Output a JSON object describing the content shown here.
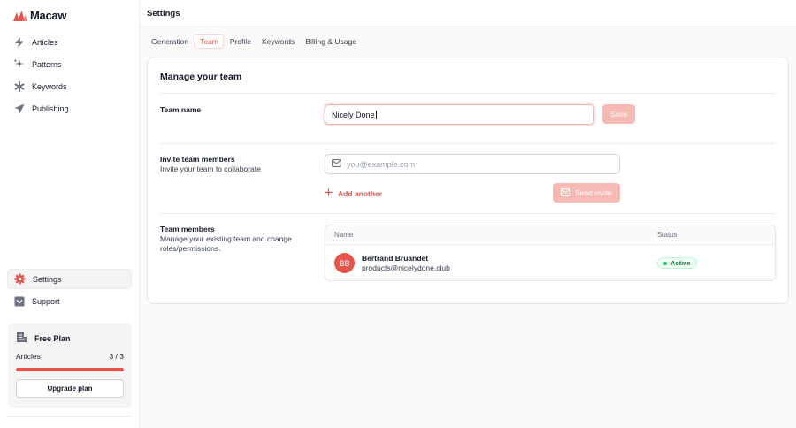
{
  "app": {
    "name": "Macaw",
    "brand_color": "#e5534b"
  },
  "sidebar": {
    "items": [
      {
        "label": "Articles",
        "icon": "lightning-icon"
      },
      {
        "label": "Patterns",
        "icon": "sparkles-icon"
      },
      {
        "label": "Keywords",
        "icon": "asterisk-icon"
      },
      {
        "label": "Publishing",
        "icon": "send-icon"
      }
    ],
    "bottom_items": [
      {
        "label": "Settings",
        "icon": "gear-icon",
        "active": true
      },
      {
        "label": "Support",
        "icon": "support-icon"
      }
    ],
    "plan": {
      "name": "Free Plan",
      "metric_label": "Articles",
      "usage_text": "3 / 3",
      "usage_fraction": 1.0,
      "upgrade_label": "Upgrade plan"
    }
  },
  "header": {
    "title": "Settings"
  },
  "tabs": [
    {
      "label": "Generation",
      "active": false
    },
    {
      "label": "Team",
      "active": true
    },
    {
      "label": "Profile",
      "active": false
    },
    {
      "label": "Keywords",
      "active": false
    },
    {
      "label": "Billing & Usage",
      "active": false
    }
  ],
  "team": {
    "title": "Manage your team",
    "name_section": {
      "label": "Team name",
      "value": "Nicely Done",
      "save_label": "Save"
    },
    "invite_section": {
      "label": "Invite team members",
      "description": "Invite your team to collaborate",
      "email_placeholder": "you@example.com",
      "add_another_label": "Add another",
      "send_label": "Send invite"
    },
    "members_section": {
      "label": "Team members",
      "description": "Manage your existing team and change roles/permissions.",
      "columns": {
        "name": "Name",
        "status": "Status"
      },
      "members": [
        {
          "initials": "BB",
          "name": "Bertrand Bruandet",
          "email": "products@nicelydone.club",
          "status": "Active"
        }
      ]
    }
  }
}
